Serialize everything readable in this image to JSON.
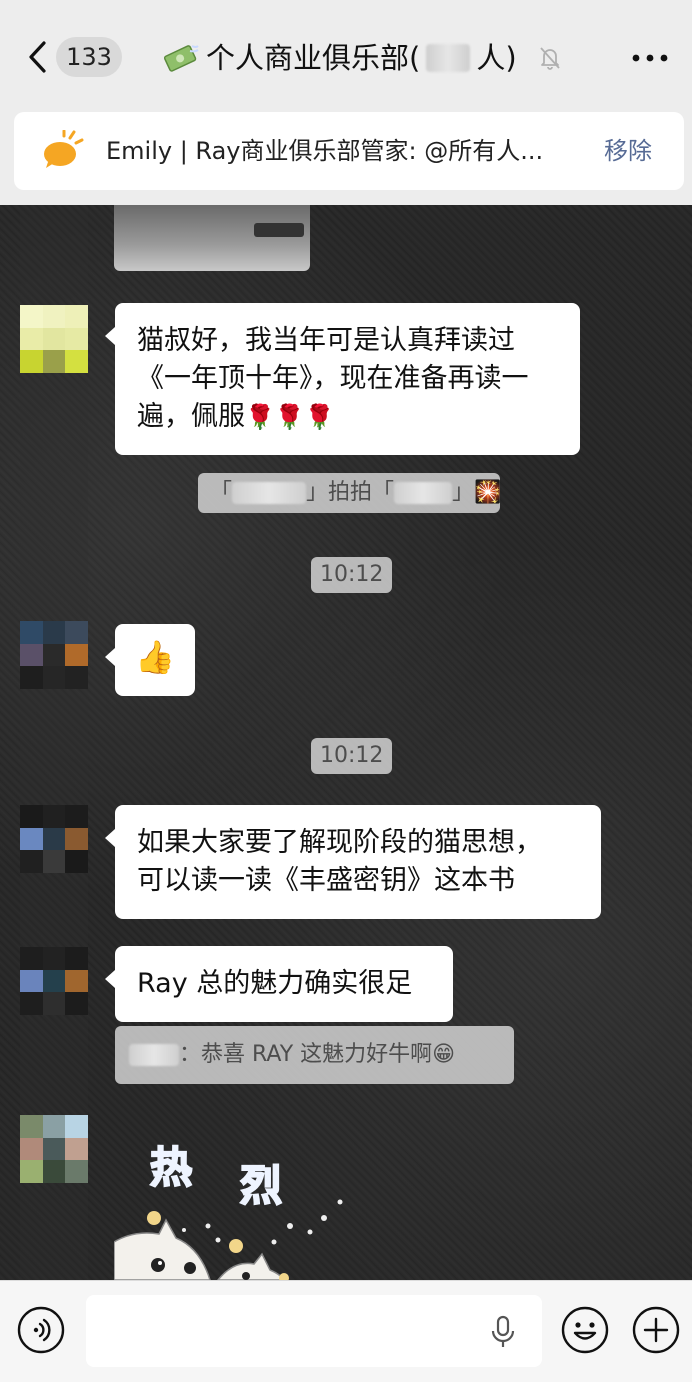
{
  "header": {
    "unread_count": "133",
    "title_prefix": "个人商业俱乐部(",
    "title_suffix": "人)"
  },
  "notice": {
    "text": "Emily | Ray商业俱乐部管家: @所有人...",
    "remove_label": "移除"
  },
  "messages": {
    "m1": "猫叔好，我当年可是认真拜读过《一年顶十年》，现在准备再读一遍，佩服",
    "m1_emoji": "🌹🌹🌹",
    "pat_open": "「",
    "pat_close": "」",
    "pat_text": "拍拍「",
    "pat_emoji": "🎇",
    "time1": "10:12",
    "thumbs_emoji": "👍",
    "time2": "10:12",
    "m3_line1": "如果大家要了解现阶段的猫思想，",
    "m3_line2": "可以读一读《丰盛密钥》这本书",
    "m4": "Ray 总的魅力确实很足",
    "quote": "：恭喜 RAY 这魅力好牛啊",
    "quote_emoji": "😁",
    "sticker_text": "热 烈"
  },
  "colors": {
    "accent_link": "#576b95",
    "chat_bg": "#282828",
    "bubble_bg": "#ffffff"
  }
}
